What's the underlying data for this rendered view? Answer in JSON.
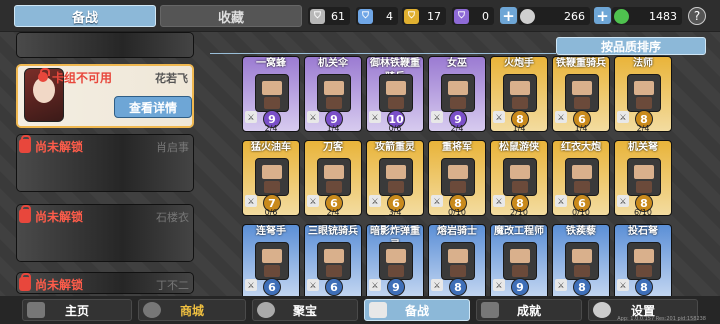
{
  "top": {
    "tab_active": "备战",
    "tab_other": "收藏",
    "resources": [
      {
        "icon": "silver-shield-icon",
        "color": "#b8b8b8",
        "value": "61"
      },
      {
        "icon": "blue-shield-icon",
        "color": "#6fa6e6",
        "value": "4"
      },
      {
        "icon": "gold-shield-icon",
        "color": "#e0b030",
        "value": "17"
      },
      {
        "icon": "purple-shield-icon",
        "color": "#8e6ad6",
        "value": "0"
      }
    ],
    "coins": "266",
    "gems": "1483",
    "help": "?"
  },
  "sort_label": "按品质排序",
  "slots": [
    {
      "label": "卡组不可用",
      "name": "花若飞",
      "button": "查看详情"
    },
    {
      "label": "尚未解锁",
      "name": "肖启事"
    },
    {
      "label": "尚未解锁",
      "name": "石楼衣"
    },
    {
      "label": "尚未解锁",
      "name": "丁不二"
    }
  ],
  "cards": [
    {
      "name": "一窝蜂",
      "cost": "9",
      "ratio": "2/4",
      "quality": "purple"
    },
    {
      "name": "机关伞",
      "cost": "9",
      "ratio": "1/4",
      "quality": "purple"
    },
    {
      "name": "御林铁鞭重骑兵",
      "cost": "10",
      "ratio": "0/6",
      "quality": "purple"
    },
    {
      "name": "女巫",
      "cost": "9",
      "ratio": "2/4",
      "quality": "purple"
    },
    {
      "name": "火炮手",
      "cost": "8",
      "ratio": "1/4",
      "quality": "gold"
    },
    {
      "name": "铁鞭重骑兵",
      "cost": "6",
      "ratio": "1/4",
      "quality": "gold"
    },
    {
      "name": "法师",
      "cost": "8",
      "ratio": "2/4",
      "quality": "gold"
    },
    {
      "name": "猛火油车",
      "cost": "7",
      "ratio": "0/6",
      "quality": "gold"
    },
    {
      "name": "刀客",
      "cost": "6",
      "ratio": "2/4",
      "quality": "gold"
    },
    {
      "name": "攻箭重灵",
      "cost": "6",
      "ratio": "3/4",
      "quality": "gold"
    },
    {
      "name": "重将军",
      "cost": "8",
      "ratio": "0/10",
      "quality": "gold"
    },
    {
      "name": "松鼠游侠",
      "cost": "8",
      "ratio": "2/10",
      "quality": "gold"
    },
    {
      "name": "红衣大炮",
      "cost": "6",
      "ratio": "0/10",
      "quality": "gold"
    },
    {
      "name": "机关弩",
      "cost": "8",
      "ratio": "6/10",
      "quality": "gold"
    },
    {
      "name": "连弩手",
      "cost": "6",
      "ratio": "",
      "quality": "blue"
    },
    {
      "name": "三眼铳骑兵",
      "cost": "6",
      "ratio": "",
      "quality": "blue"
    },
    {
      "name": "暗影炸弹重灵",
      "cost": "9",
      "ratio": "",
      "quality": "blue"
    },
    {
      "name": "熔岩骑士",
      "cost": "8",
      "ratio": "",
      "quality": "blue"
    },
    {
      "name": "魔改工程师",
      "cost": "9",
      "ratio": "",
      "quality": "blue"
    },
    {
      "name": "铁蒺藜",
      "cost": "8",
      "ratio": "",
      "quality": "blue"
    },
    {
      "name": "投石弩",
      "cost": "8",
      "ratio": "",
      "quality": "blue"
    }
  ],
  "nav": [
    {
      "id": "home",
      "label": "主页"
    },
    {
      "id": "shop",
      "label": "商城"
    },
    {
      "id": "treasure",
      "label": "聚宝"
    },
    {
      "id": "prepare",
      "label": "备战"
    },
    {
      "id": "achieve",
      "label": "成就"
    },
    {
      "id": "settings",
      "label": "设置"
    }
  ],
  "version": "App: 1.0.0.157 Res:201 pid:158238"
}
